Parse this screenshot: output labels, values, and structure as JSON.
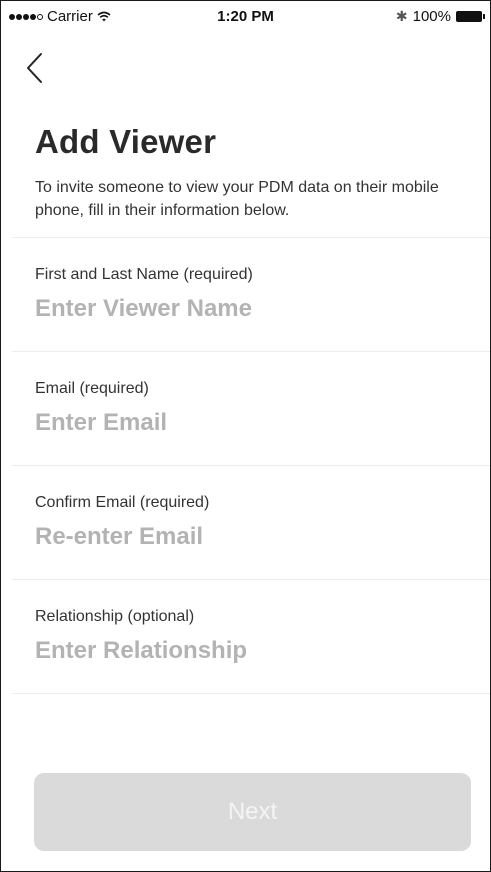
{
  "status_bar": {
    "carrier": "Carrier",
    "time": "1:20 PM",
    "bluetooth_symbol": "✱",
    "battery": "100%",
    "icons": [
      "signal-dots-icon",
      "wifi-icon",
      "bluetooth-icon",
      "battery-icon"
    ]
  },
  "nav": {
    "back_icon": "chevron-left-icon"
  },
  "header": {
    "title": "Add Viewer",
    "description": "To invite someone to view your PDM data on their mobile phone, fill in their information below."
  },
  "form": {
    "fields": [
      {
        "label": "First and Last Name (required)",
        "placeholder": "Enter Viewer Name",
        "value": ""
      },
      {
        "label": "Email (required)",
        "placeholder": "Enter Email",
        "value": ""
      },
      {
        "label": "Confirm Email (required)",
        "placeholder": "Re-enter Email",
        "value": ""
      },
      {
        "label": "Relationship (optional)",
        "placeholder": "Enter Relationship",
        "value": ""
      }
    ]
  },
  "actions": {
    "next_label": "Next",
    "next_enabled": false
  },
  "colors": {
    "placeholder": "#b3b3b3",
    "button_disabled_bg": "#dadada",
    "button_disabled_text": "#f4f4f4",
    "divider": "#ececec"
  }
}
